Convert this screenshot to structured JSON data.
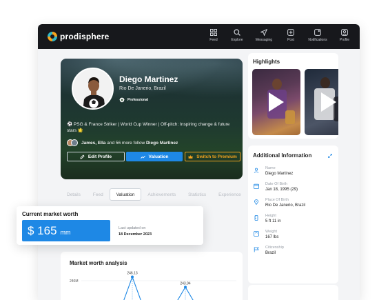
{
  "app": {
    "brand": "prodisphere"
  },
  "nav": [
    {
      "label": "Feed",
      "icon": "grid-icon"
    },
    {
      "label": "Explore",
      "icon": "search-icon"
    },
    {
      "label": "Messaging",
      "icon": "send-icon"
    },
    {
      "label": "Post",
      "icon": "plus-square-icon"
    },
    {
      "label": "Notifications",
      "icon": "bell-icon"
    },
    {
      "label": "Profile",
      "icon": "user-icon"
    }
  ],
  "profile": {
    "name": "Diego Martinez",
    "location": "Rio De Janerio, Brazil",
    "badge": "Professional",
    "bio": "⚽ PSG & France Striker | World Cup Winner | Off-pitch: Inspiring change & future stars 🌟",
    "followers_names": "James, Ella",
    "followers_middle": " and 56 more follow ",
    "followers_target": "Diego Martinez"
  },
  "actions": {
    "edit": "Edit Profile",
    "valuation": "Valuation",
    "premium": "Switch to Premium"
  },
  "tabs": [
    "Details",
    "Feed",
    "Valuation",
    "Achievements",
    "Statistics",
    "Experience"
  ],
  "active_tab": "Valuation",
  "market_worth": {
    "title": "Current market worth",
    "amount": "$ 165",
    "unit": "mm",
    "updated_label": "Last updated on",
    "updated_date": "18 December 2023"
  },
  "analysis": {
    "title": "Market worth analysis",
    "chart_data": {
      "type": "line",
      "y_tick": "240M",
      "points": [
        {
          "label": "246.13",
          "value": 246.13
        },
        {
          "label": "243.94",
          "value": 243.94
        }
      ]
    }
  },
  "highlights": {
    "title": "Highlights"
  },
  "additional_info": {
    "title": "Additional Information",
    "fields": [
      {
        "label": "Name",
        "value": "Diego Martinez",
        "icon": "person-icon"
      },
      {
        "label": "Date Of Birth",
        "value": "Jan 18, 1995 (29)",
        "icon": "calendar-icon"
      },
      {
        "label": "Place Of Birth",
        "value": "Rio De Janerio, Brazil",
        "icon": "pin-icon"
      },
      {
        "label": "Height",
        "value": "5 ft 11 in",
        "icon": "ruler-icon"
      },
      {
        "label": "Weight",
        "value": "167 lbs",
        "icon": "scale-icon"
      },
      {
        "label": "Citizenship",
        "value": "Brazil",
        "icon": "flag-icon"
      }
    ]
  },
  "colors": {
    "primary": "#1e88e5",
    "accent": "#f0a21e",
    "topbar": "#17181c"
  }
}
